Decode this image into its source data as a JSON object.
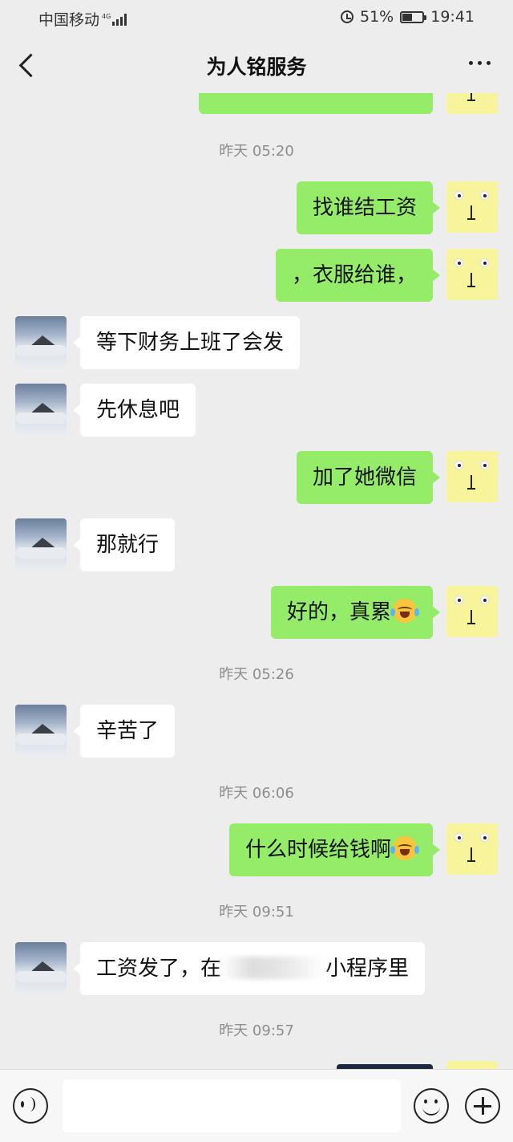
{
  "status_bar": {
    "carrier": "中国移动",
    "network": "4G",
    "battery": "51%",
    "time": "19:41"
  },
  "nav": {
    "title": "为人铭服务"
  },
  "timestamps": [
    "昨天 05:20",
    "昨天 05:26",
    "昨天 06:06",
    "昨天 09:51",
    "昨天 09:57"
  ],
  "messages": [
    {
      "side": "right",
      "text": "找谁结工资"
    },
    {
      "side": "right",
      "text": "，衣服给谁，"
    },
    {
      "side": "left",
      "text": "等下财务上班了会发"
    },
    {
      "side": "left",
      "text": "先休息吧"
    },
    {
      "side": "right",
      "text": "加了她微信"
    },
    {
      "side": "left",
      "text": "那就行"
    },
    {
      "side": "right",
      "text": "好的，真累"
    },
    {
      "side": "left",
      "text": "辛苦了"
    },
    {
      "side": "right",
      "text": "什么时候给钱啊"
    },
    {
      "side": "left",
      "text_before": "工资发了，在",
      "text_after": "小程序里"
    }
  ],
  "icons": {
    "back": "chevron-left-icon",
    "more": "more-icon",
    "voice": "voice-icon",
    "emoji": "smile-icon",
    "plus": "plus-icon",
    "laugh_cry": "laugh-cry-emoji"
  },
  "colors": {
    "sent_bubble": "#95ec69",
    "received_bubble": "#ffffff",
    "background": "#ededed"
  }
}
